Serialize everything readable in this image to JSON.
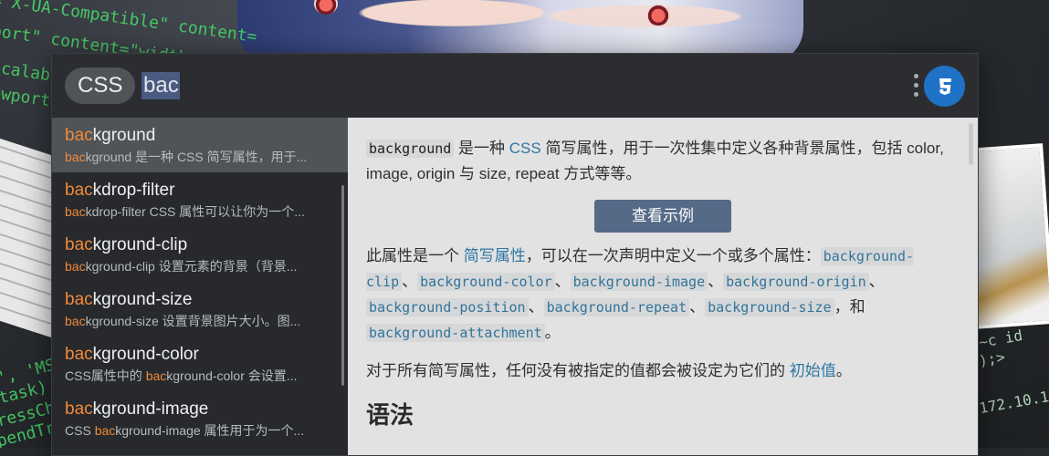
{
  "search": {
    "tag": "CSS",
    "query": "bac"
  },
  "results": [
    {
      "hl": "bac",
      "rest": "kground",
      "desc_hl": "bac",
      "desc_rest": "kground 是一种 CSS 简写属性，用于...",
      "desc_pre": ""
    },
    {
      "hl": "bac",
      "rest": "kdrop-filter",
      "desc_hl": "bac",
      "desc_rest": "kdrop-filter CSS 属性可以让你为一个...",
      "desc_pre": ""
    },
    {
      "hl": "bac",
      "rest": "kground-clip",
      "desc_hl": "bac",
      "desc_rest": "kground-clip 设置元素的背景（背景...",
      "desc_pre": ""
    },
    {
      "hl": "bac",
      "rest": "kground-size",
      "desc_hl": "bac",
      "desc_rest": "kground-size 设置背景图片大小。图...",
      "desc_pre": ""
    },
    {
      "hl": "bac",
      "rest": "kground-color",
      "desc_pre": "CSS属性中的 ",
      "desc_hl": "bac",
      "desc_rest": "kground-color 会设置..."
    },
    {
      "hl": "bac",
      "rest": "kground-image",
      "desc_pre": "CSS ",
      "desc_hl": "bac",
      "desc_rest": "kground-image 属性用于为一个..."
    }
  ],
  "detail": {
    "intro_code": "background",
    "intro_text1": " 是一种 ",
    "intro_link": "CSS",
    "intro_text2": " 简写属性，用于一次性集中定义各种背景属性，包括 color, image, origin 与 size, repeat 方式等等。",
    "example_button": "查看示例",
    "p2_text1": "此属性是一个 ",
    "p2_link": "简写属性",
    "p2_text2": "，可以在一次声明中定义一个或多个属性：",
    "p2_codes": [
      "background-clip",
      "background-color",
      "background-image",
      "background-origin",
      "background-position",
      "background-repeat",
      "background-size",
      "background-attachment"
    ],
    "sep": "、",
    "and": "，和 ",
    "end": "。",
    "p3_text": "对于所有简写属性，任何没有被指定的值都会被设定为它们的 ",
    "p3_link": "初始值",
    "p3_end": "。",
    "syntax_heading": "语法"
  },
  "colors": {
    "accent_highlight": "#f18a3b",
    "selected_bg": "#505357",
    "button_bg": "#556a87",
    "link": "#2f77a3",
    "logo_bg": "#1f72c6"
  },
  "icons": {
    "menu": "more-vert-icon",
    "logo": "css3-logo-icon"
  }
}
